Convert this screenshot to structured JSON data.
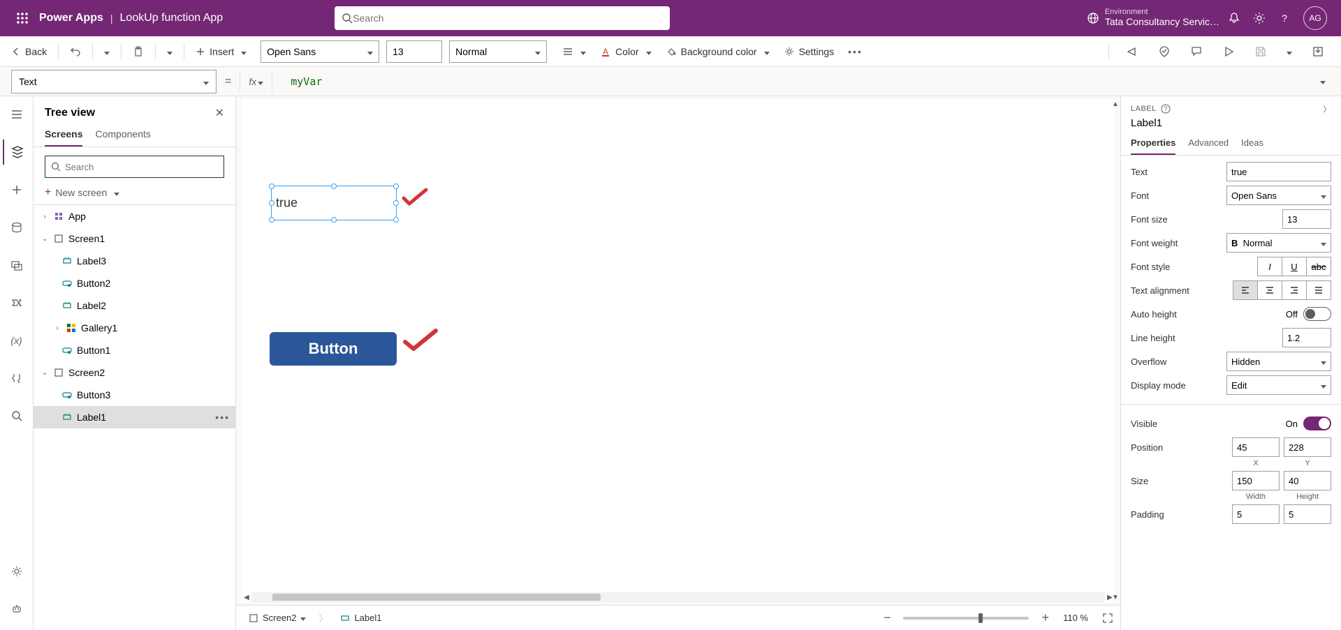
{
  "brand": {
    "product": "Power Apps",
    "separator": "|",
    "app_name": "LookUp function App"
  },
  "search": {
    "placeholder": "Search"
  },
  "environment": {
    "label": "Environment",
    "name": "Tata Consultancy Servic…"
  },
  "avatar": "AG",
  "cmd": {
    "back": "Back",
    "insert": "Insert",
    "font": "Open Sans",
    "font_size": "13",
    "font_weight": "Normal",
    "color": "Color",
    "bgcolor": "Background color",
    "settings": "Settings"
  },
  "formula": {
    "property": "Text",
    "value": "myVar"
  },
  "tree": {
    "title": "Tree view",
    "tabs": {
      "screens": "Screens",
      "components": "Components"
    },
    "search_placeholder": "Search",
    "new_screen": "New screen",
    "app": "App",
    "screen1": "Screen1",
    "items1": {
      "label3": "Label3",
      "button2": "Button2",
      "label2": "Label2",
      "gallery1": "Gallery1",
      "button1": "Button1"
    },
    "screen2": "Screen2",
    "items2": {
      "button3": "Button3",
      "label1": "Label1"
    }
  },
  "canvas": {
    "label_text": "true",
    "button_text": "Button"
  },
  "status": {
    "screen": "Screen2",
    "control": "Label1",
    "zoom": "110 %"
  },
  "props": {
    "header": "LABEL",
    "name": "Label1",
    "tabs": {
      "properties": "Properties",
      "advanced": "Advanced",
      "ideas": "Ideas"
    },
    "text_label": "Text",
    "text_value": "true",
    "font_label": "Font",
    "font_value": "Open Sans",
    "fontsize_label": "Font size",
    "fontsize_value": "13",
    "fontweight_label": "Font weight",
    "fontweight_value": "Normal",
    "fontstyle_label": "Font style",
    "align_label": "Text alignment",
    "autoh_label": "Auto height",
    "autoh_value": "Off",
    "lineh_label": "Line height",
    "lineh_value": "1.2",
    "overflow_label": "Overflow",
    "overflow_value": "Hidden",
    "display_label": "Display mode",
    "display_value": "Edit",
    "visible_label": "Visible",
    "visible_value": "On",
    "position_label": "Position",
    "pos_x": "45",
    "pos_y": "228",
    "pos_x_lbl": "X",
    "pos_y_lbl": "Y",
    "size_label": "Size",
    "size_w": "150",
    "size_h": "40",
    "size_w_lbl": "Width",
    "size_h_lbl": "Height",
    "padding_label": "Padding",
    "pad_t": "5",
    "pad_r": "5"
  }
}
